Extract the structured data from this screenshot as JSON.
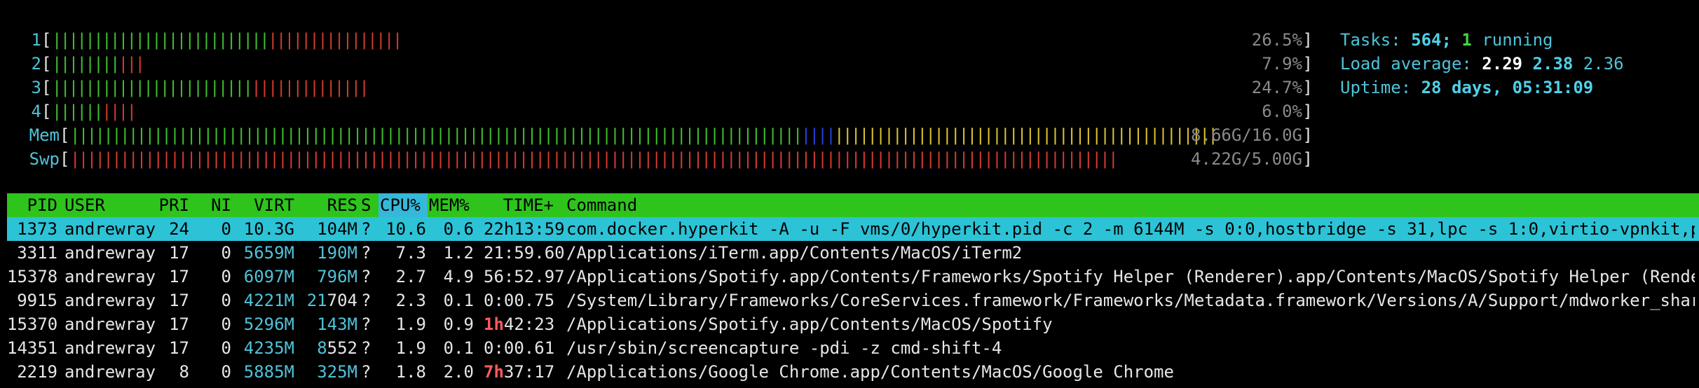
{
  "meters": [
    {
      "label": "1",
      "green": 26,
      "red": 16,
      "value": "26.5%"
    },
    {
      "label": "2",
      "green": 8,
      "red": 3,
      "value": "7.9%"
    },
    {
      "label": "3",
      "green": 24,
      "red": 14,
      "value": "24.7%"
    },
    {
      "label": "4",
      "green": 6,
      "red": 4,
      "value": "6.0%"
    }
  ],
  "memory": {
    "label": "Mem",
    "green": 88,
    "blue": 4,
    "yellow": 46,
    "value": "8.66G/16.0G"
  },
  "swap": {
    "label": "Swp",
    "red": 126,
    "value": "4.22G/5.00G"
  },
  "info": {
    "tasks_label": "Tasks: ",
    "tasks_count": "564",
    "tasks_sep": "; ",
    "running_count": "1",
    "running_label": " running",
    "load_label": "Load average: ",
    "load1": "2.29",
    "load5": "2.38",
    "load15": "2.36",
    "uptime_label": "Uptime: ",
    "uptime_value": "28 days, 05:31:09"
  },
  "columns": {
    "pid": "PID",
    "user": "USER",
    "pri": "PRI",
    "ni": "NI",
    "virt": "VIRT",
    "res": "RES",
    "s": "S",
    "cpu": "CPU%",
    "mem": "MEM%",
    "time": "TIME+",
    "command": "Command"
  },
  "processes": [
    {
      "pid": "1373",
      "user": "andrewray",
      "pri": "24",
      "ni": "0",
      "virt_a": "10.3G",
      "virt_b": "",
      "res_a": "104M",
      "res_b": "",
      "s": "?",
      "cpu": "10.6",
      "mem": "0.6",
      "time_a": "",
      "time_b": "22h13:59",
      "command": "com.docker.hyperkit -A -u -F vms/0/hyperkit.pid -c 2 -m 6144M -s 0:0,hostbridge -s 31,lpc -s 1:0,virtio-vpnkit,path=",
      "selected": true
    },
    {
      "pid": "3311",
      "user": "andrewray",
      "pri": "17",
      "ni": "0",
      "virt_a": "5659M",
      "virt_b": "",
      "res_a": "190M",
      "res_b": "",
      "s": "?",
      "cpu": "7.3",
      "mem": "1.2",
      "time_a": "",
      "time_b": "21:59.60",
      "command": "/Applications/iTerm.app/Contents/MacOS/iTerm2",
      "selected": false
    },
    {
      "pid": "15378",
      "user": "andrewray",
      "pri": "17",
      "ni": "0",
      "virt_a": "6097M",
      "virt_b": "",
      "res_a": "796M",
      "res_b": "",
      "s": "?",
      "cpu": "2.7",
      "mem": "4.9",
      "time_a": "",
      "time_b": "56:52.97",
      "command": "/Applications/Spotify.app/Contents/Frameworks/Spotify Helper (Renderer).app/Contents/MacOS/Spotify Helper (Renderer)",
      "selected": false
    },
    {
      "pid": "9915",
      "user": "andrewray",
      "pri": "17",
      "ni": "0",
      "virt_a": "4221M",
      "virt_b": "",
      "res_a": "21",
      "res_b": "704",
      "s": "?",
      "cpu": "2.3",
      "mem": "0.1",
      "time_a": "",
      "time_b": "0:00.75",
      "command": "/System/Library/Frameworks/CoreServices.framework/Frameworks/Metadata.framework/Versions/A/Support/mdworker_shared -",
      "selected": false
    },
    {
      "pid": "15370",
      "user": "andrewray",
      "pri": "17",
      "ni": "0",
      "virt_a": "5296M",
      "virt_b": "",
      "res_a": "143M",
      "res_b": "",
      "s": "?",
      "cpu": "1.9",
      "mem": "0.9",
      "time_a": "1h",
      "time_b": "42:23",
      "command": "/Applications/Spotify.app/Contents/MacOS/Spotify",
      "selected": false
    },
    {
      "pid": "14351",
      "user": "andrewray",
      "pri": "17",
      "ni": "0",
      "virt_a": "4235M",
      "virt_b": "",
      "res_a": "8",
      "res_b": "552",
      "s": "?",
      "cpu": "1.9",
      "mem": "0.1",
      "time_a": "",
      "time_b": "0:00.61",
      "command": "/usr/sbin/screencapture -pdi -z cmd-shift-4",
      "selected": false
    },
    {
      "pid": "2219",
      "user": "andrewray",
      "pri": "8",
      "ni": "0",
      "virt_a": "5885M",
      "virt_b": "",
      "res_a": "325M",
      "res_b": "",
      "s": "?",
      "cpu": "1.8",
      "mem": "2.0",
      "time_a": "7h",
      "time_b": "37:17",
      "command": "/Applications/Google Chrome.app/Contents/MacOS/Google Chrome",
      "selected": false
    }
  ],
  "colors": {
    "header_bg": "#2ec41c",
    "selected_bg": "#2cc3d6",
    "sorted_col_bg": "#35b8d9",
    "bar_green": "#3fbf2f",
    "bar_red": "#d33a2f",
    "bar_blue": "#2a3fd8",
    "bar_yellow": "#d8c52f"
  }
}
